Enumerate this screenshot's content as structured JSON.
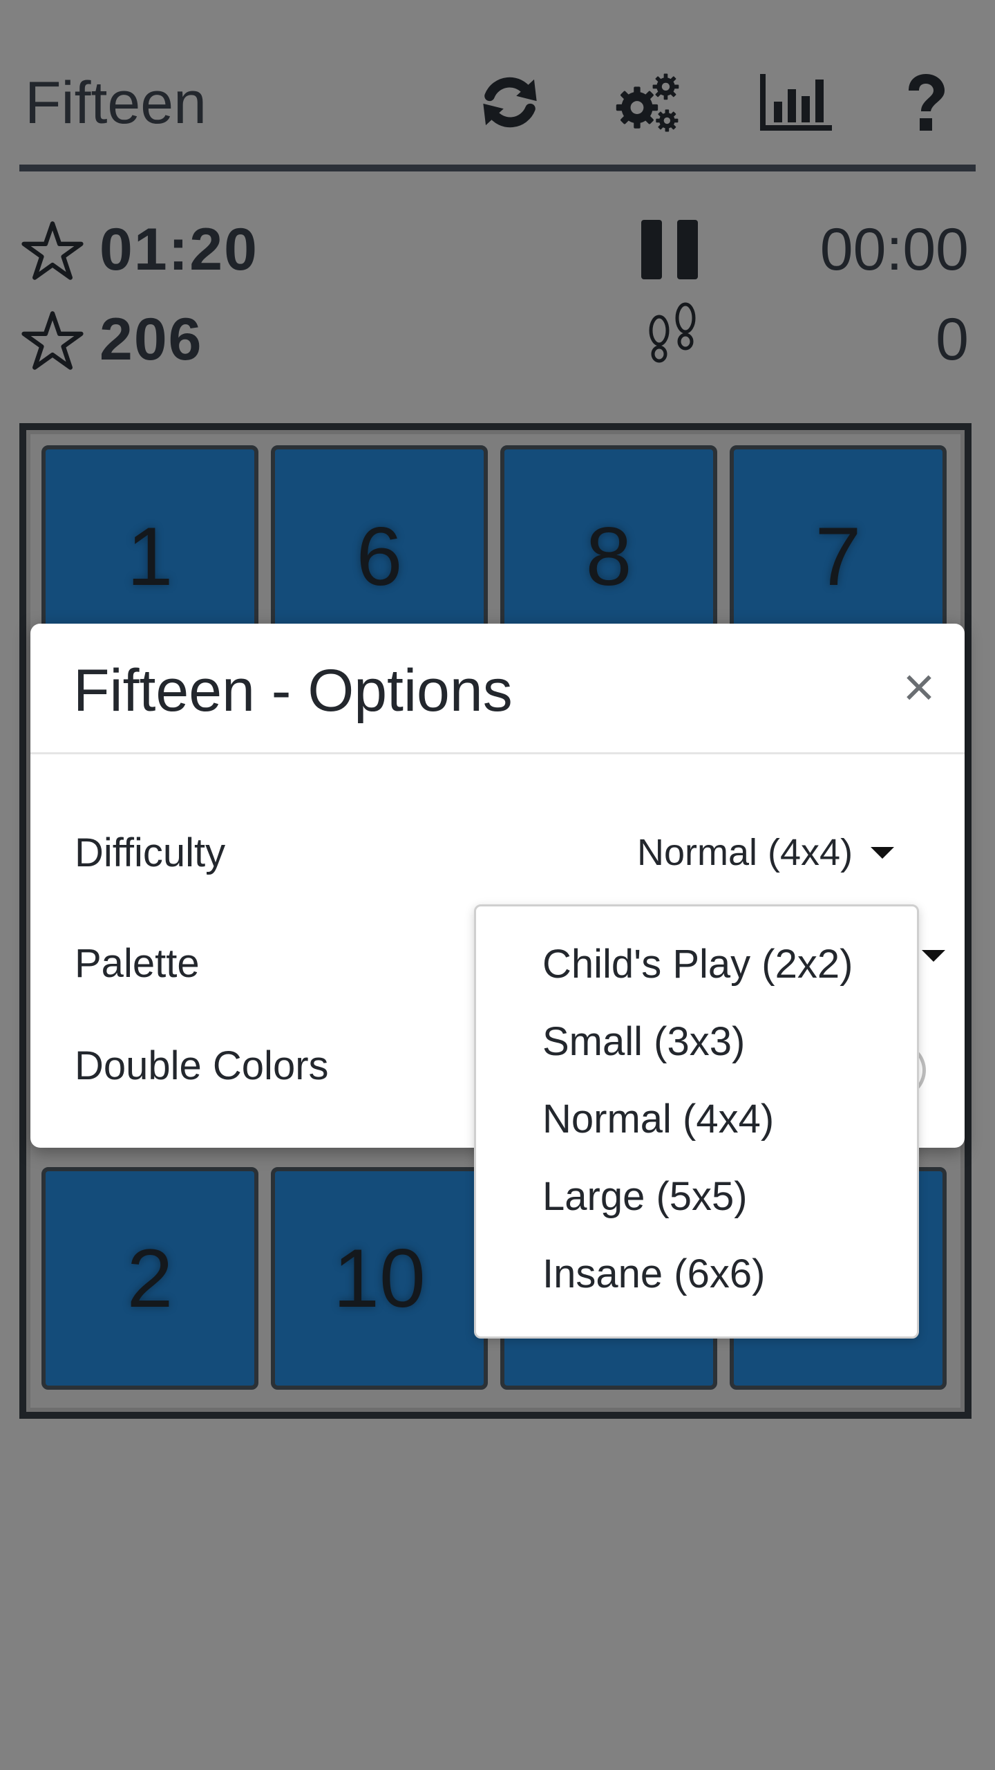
{
  "app": {
    "title": "Fifteen"
  },
  "header": {
    "icons": [
      "refresh-icon",
      "settings-gears-icon",
      "statistics-chart-icon",
      "help-question-icon"
    ]
  },
  "stats": {
    "best_time": "01:20",
    "best_moves": "206",
    "current_time": "00:00",
    "current_moves": "0"
  },
  "board": {
    "tiles_visible": [
      "1",
      "6",
      "8",
      "7",
      "2",
      "10",
      "",
      ""
    ],
    "tile_color": "#144c7a"
  },
  "options_modal": {
    "title": "Fifteen - Options",
    "close_label": "×",
    "difficulty_label": "Difficulty",
    "difficulty_value": "Normal (4x4)",
    "palette_label": "Palette",
    "double_colors_label": "Double Colors"
  },
  "difficulty_dropdown": {
    "options": [
      "Child's Play (2x2)",
      "Small (3x3)",
      "Normal (4x4)",
      "Large (5x5)",
      "Insane (6x6)"
    ]
  }
}
